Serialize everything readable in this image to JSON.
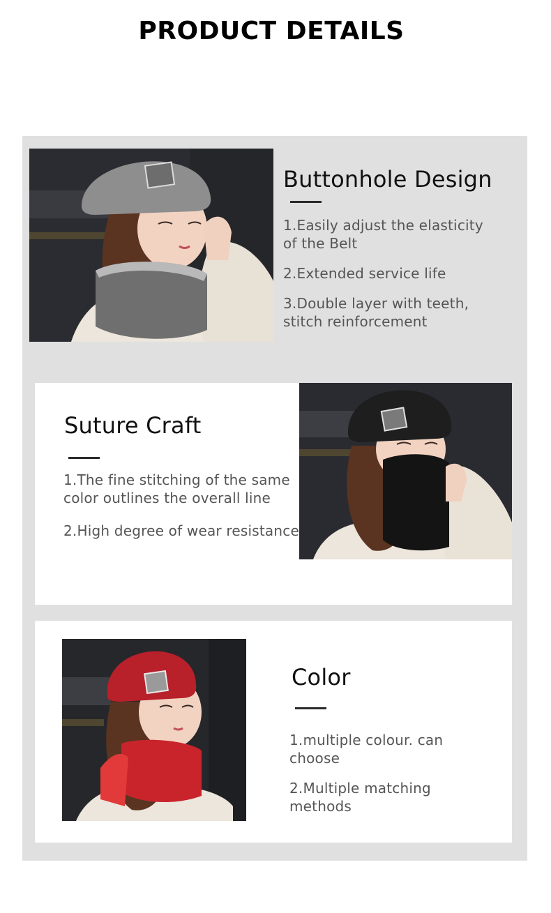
{
  "page": {
    "title": "PRODUCT DETAILS"
  },
  "sections": [
    {
      "heading": "Buttonhole Design",
      "points": [
        "1.Easily adjust the elasticity of the Belt",
        "2.Extended service life",
        "3.Double layer with teeth, stitch reinforcement"
      ],
      "image": {
        "hat_color": "#8e8e8e",
        "scarf_color": "#6f6f6f",
        "scarf_trim": "#b9b9b9"
      }
    },
    {
      "heading": "Suture Craft",
      "points": [
        "1.The fine stitching of the same color outlines the overall line",
        "2.High degree of wear resistance"
      ],
      "image": {
        "hat_color": "#1e1e1e",
        "scarf_color": "#141414",
        "scarf_trim": "#2a2a2a"
      }
    },
    {
      "heading": "Color",
      "points": [
        "1.multiple colour. can choose",
        "2.Multiple matching methods"
      ],
      "image": {
        "hat_color": "#b8202a",
        "scarf_color": "#c9242c",
        "scarf_trim": "#e23a3a"
      }
    }
  ],
  "colors": {
    "panel_bg": "#e0e0e0",
    "card_bg": "#ffffff",
    "heading": "#111111",
    "body_text": "#555555",
    "accent_rule": "#2a2a2a"
  }
}
